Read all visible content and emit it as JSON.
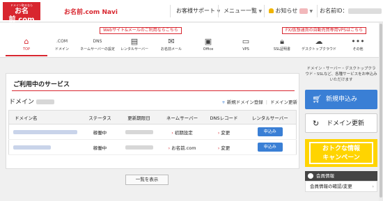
{
  "header": {
    "logo_small": "ドメイン取るなら",
    "logo_main": "お名前.com",
    "nav_title": "お名前.com Navi",
    "support_label": "お客様サポート",
    "menu_label": "メニュー一覧",
    "notice_label": "お知らせ",
    "user_id_label": "お名前ID："
  },
  "promos": {
    "left": "Webサイト&メールのご利用ならこちら",
    "right": "FX/仮想通貨の自動売買専用VPSはこちら"
  },
  "icons": [
    {
      "label": "TOP",
      "glyph": "home-icon"
    },
    {
      "label": "ドメイン",
      "glyph": "com-icon"
    },
    {
      "label": "ネームサーバーの設定",
      "glyph": "dns-icon"
    },
    {
      "label": "レンタルサーバー",
      "glyph": "server-icon"
    },
    {
      "label": "お名前メール",
      "glyph": "mail-icon"
    },
    {
      "label": "Office",
      "glyph": "office-icon"
    },
    {
      "label": "VPS",
      "glyph": "vps-icon"
    },
    {
      "label": "SSL証明書",
      "glyph": "lock-icon"
    },
    {
      "label": "デスクトップクラウド",
      "glyph": "cloud-icon"
    },
    {
      "label": "その他",
      "glyph": "more-icon"
    }
  ],
  "main": {
    "title": "ご利用中のサービス",
    "domain_label": "ドメイン",
    "register_link": "新規ドメイン登録",
    "renew_link": "ドメイン更新",
    "columns": [
      "ドメイン名",
      "ステータス",
      "更新期限日",
      "ネームサーバー",
      "DNSレコード",
      "レンタルサーバー"
    ],
    "rows": [
      {
        "status": "稼働中",
        "nameserver": "初期設定",
        "dns": "変更",
        "server": "申込み"
      },
      {
        "status": "稼働中",
        "nameserver": "お名前.com",
        "dns": "変更",
        "server": "申込み"
      }
    ],
    "show_all": "一覧を表示"
  },
  "sidebar": {
    "info": "ドメイン・サーバー・デスクトップクラウド・SSLなど、各種サービスをお申込みいただけます",
    "new_apply": "新規申込み",
    "domain_renew": "ドメイン更新",
    "banner_line1": "おトクな情報",
    "banner_line2": "キャンペーン",
    "member_title": "会員情報",
    "member_link": "会員情報の確認/変更"
  },
  "colors": {
    "brand": "#d8262f",
    "primary": "#3a7fd5",
    "banner": "#ffd400"
  }
}
